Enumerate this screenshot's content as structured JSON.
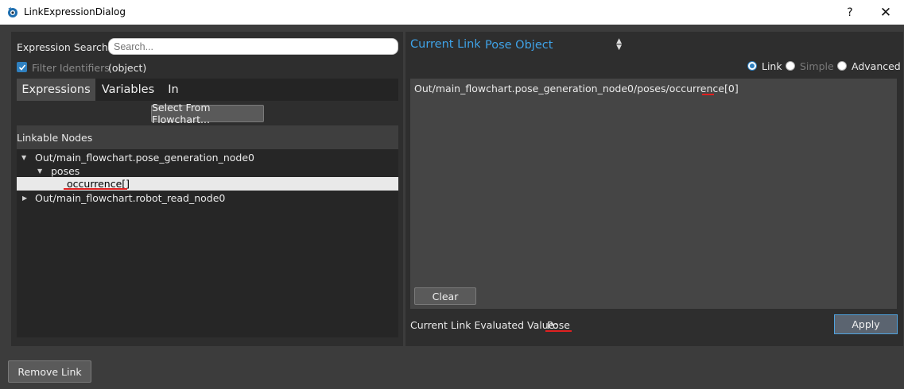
{
  "window": {
    "title": "LinkExpressionDialog",
    "help_label": "?",
    "close_label": "✕"
  },
  "left": {
    "search_label": "Expression Search:",
    "search_placeholder": "Search...",
    "search_value": "",
    "filter_label": "Filter Identifiers",
    "filter_checked": true,
    "filter_value": "(object)",
    "tabs": [
      {
        "label": "Expressions",
        "active": true
      },
      {
        "label": "Variables",
        "active": false
      },
      {
        "label": "In",
        "active": false
      }
    ],
    "select_button": "Select From Flowchart...",
    "tree_header": "Linkable Nodes",
    "tree_items": [
      {
        "label": "Out/main_flowchart.pose_generation_node0",
        "expanded": true
      },
      {
        "label": "poses",
        "expanded": true
      },
      {
        "label": "occurrence[]",
        "selected": true
      },
      {
        "label": "Out/main_flowchart.robot_read_node0",
        "expanded": false
      }
    ]
  },
  "right": {
    "current_link_label": "Current Link:",
    "current_link_value": "Pose Object",
    "modes": [
      {
        "label": "Link",
        "checked": true,
        "enabled": true
      },
      {
        "label": "Simple",
        "checked": false,
        "enabled": false
      },
      {
        "label": "Advanced",
        "checked": false,
        "enabled": true
      }
    ],
    "expression_prefix": "Out/main_flowchart.pose_generation_node0/poses/occurrence",
    "expression_index": "[0]",
    "clear_button": "Clear",
    "evaluated_label": "Current Link Evaluated Value:",
    "evaluated_value": "Pose",
    "apply_button": "Apply"
  },
  "footer": {
    "remove_button": "Remove Link"
  },
  "colors": {
    "accent": "#3fa3e8",
    "error_underline": "#e02020",
    "background": "#3c3c3c"
  }
}
